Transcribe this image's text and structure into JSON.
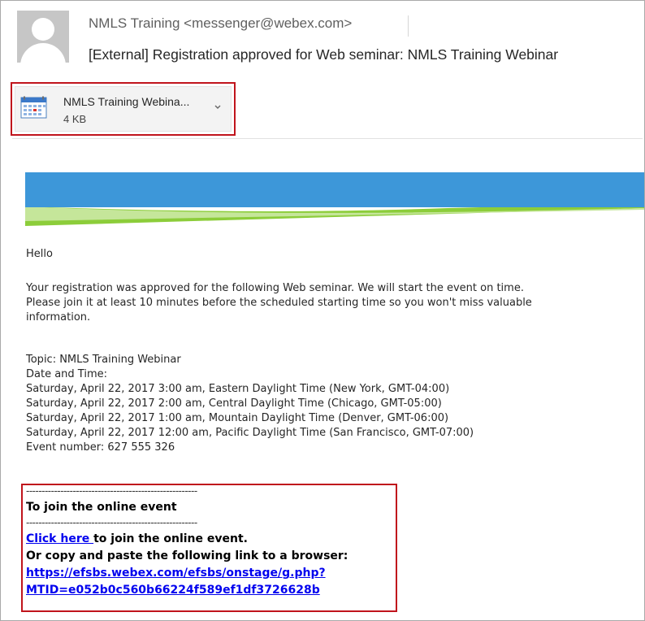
{
  "header": {
    "sender": "NMLS Training <messenger@webex.com>",
    "subject": "[External] Registration approved for Web seminar: NMLS Training Webinar"
  },
  "attachment": {
    "name": "NMLS Training Webina...",
    "size": "4 KB",
    "icon": "calendar-icon",
    "menu_icon": "chevron-down-icon"
  },
  "banner": {
    "color_top": "#3d97d9",
    "color_accent": "#8ccd3a"
  },
  "body": {
    "greeting": "Hello",
    "intro_lines": [
      "Your registration was approved for the following Web seminar. We will start the event on time.",
      "Please join it at least 10 minutes before the scheduled starting time so you won't miss valuable",
      "information."
    ],
    "details_lines": [
      "Topic: NMLS Training Webinar",
      "Date and Time:",
      "Saturday, April 22, 2017 3:00 am, Eastern Daylight Time (New York, GMT-04:00)",
      "Saturday, April 22, 2017 2:00 am, Central Daylight Time (Chicago, GMT-05:00)",
      "Saturday, April 22, 2017 1:00 am, Mountain Daylight Time (Denver, GMT-06:00)",
      "Saturday, April 22, 2017 12:00 am, Pacific Daylight Time (San Francisco, GMT-07:00)",
      "Event number: 627 555 326"
    ]
  },
  "join": {
    "divider": "-------------------------------------------------------",
    "heading": "To join the online event",
    "click_here_label": "Click here ",
    "click_here_suffix": "to join the online event.",
    "copy_instruction": "Or copy and paste the following link to a browser:",
    "link_line1": "https://efsbs.webex.com/efsbs/onstage/g.php?",
    "link_line2": "MTID=e052b0c560b66224f589ef1df3726628b"
  },
  "colors": {
    "highlight_border": "#c0141c",
    "link": "#0000ee"
  }
}
